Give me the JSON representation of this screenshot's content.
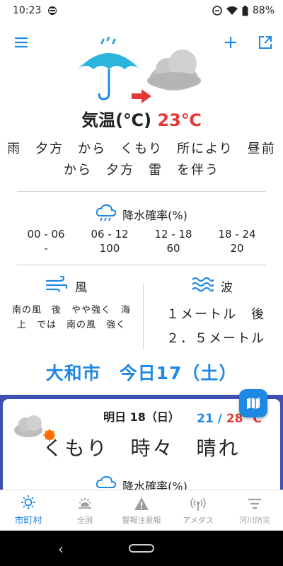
{
  "status_bar": {
    "time": "10:23",
    "battery": "88%"
  },
  "today": {
    "temp_label": "気温(℃)",
    "temp_value": "23℃",
    "forecast_line1": "雨　夕方　から　くもり　所により　昼前",
    "forecast_line2": "から　夕方　雷　を伴う",
    "precip": {
      "label": "降水確率(%)",
      "periods": [
        "00 - 06",
        "06 - 12",
        "12 - 18",
        "18 - 24"
      ],
      "values": [
        "-",
        "100",
        "60",
        "20"
      ]
    },
    "wind": {
      "label": "風",
      "line1": "南の風　後　やや強く　海",
      "line2": "上　では　南の風　強く"
    },
    "wave": {
      "label": "波",
      "line1": "１メートル　後",
      "line2": "２．５メートル"
    }
  },
  "city_title": "大和市　今日17（土）",
  "tomorrow": {
    "date": "明日 18（日）",
    "temp_low": "21",
    "temp_sep": " / ",
    "temp_high": "28 ℃",
    "weather": "くもり　時々　晴れ",
    "precip_label": "降水確率(%)"
  },
  "bottom_nav": [
    {
      "label": "市町村",
      "icon": "sun-icon"
    },
    {
      "label": "全国",
      "icon": "sunrise-icon"
    },
    {
      "label": "警報注意報",
      "icon": "warning-icon"
    },
    {
      "label": "アメダス",
      "icon": "antenna-icon"
    },
    {
      "label": "河川防災",
      "icon": "filter-icon"
    }
  ],
  "colors": {
    "accent": "#1e88e5",
    "hot": "#e53935",
    "card_border": "#3f51b5"
  }
}
